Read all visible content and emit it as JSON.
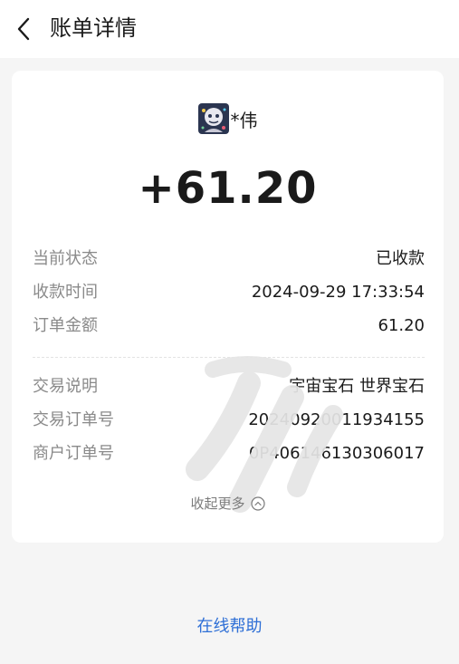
{
  "header": {
    "title": "账单详情",
    "back_icon": "chevron-left-icon"
  },
  "payee": {
    "name": "*伟",
    "avatar_icon": "avatar-icon"
  },
  "amount": "+61.20",
  "summary": [
    {
      "label": "当前状态",
      "value": "已收款"
    },
    {
      "label": "收款时间",
      "value": "2024-09-29 17:33:54"
    },
    {
      "label": "订单金额",
      "value": "61.20"
    }
  ],
  "details": [
    {
      "label": "交易说明",
      "value": "宇宙宝石 世界宝石"
    },
    {
      "label": "交易订单号",
      "value": "20240920011934155"
    },
    {
      "label": "商户订单号",
      "value": "0P406146130306017"
    }
  ],
  "collapse": {
    "label": "收起更多",
    "icon": "chevron-up-circle-icon"
  },
  "help": {
    "label": "在线帮助"
  },
  "colors": {
    "background": "#f5f5f5",
    "card": "#ffffff",
    "label_gray": "#8a8a8a",
    "link_blue": "#2e6fd6"
  }
}
